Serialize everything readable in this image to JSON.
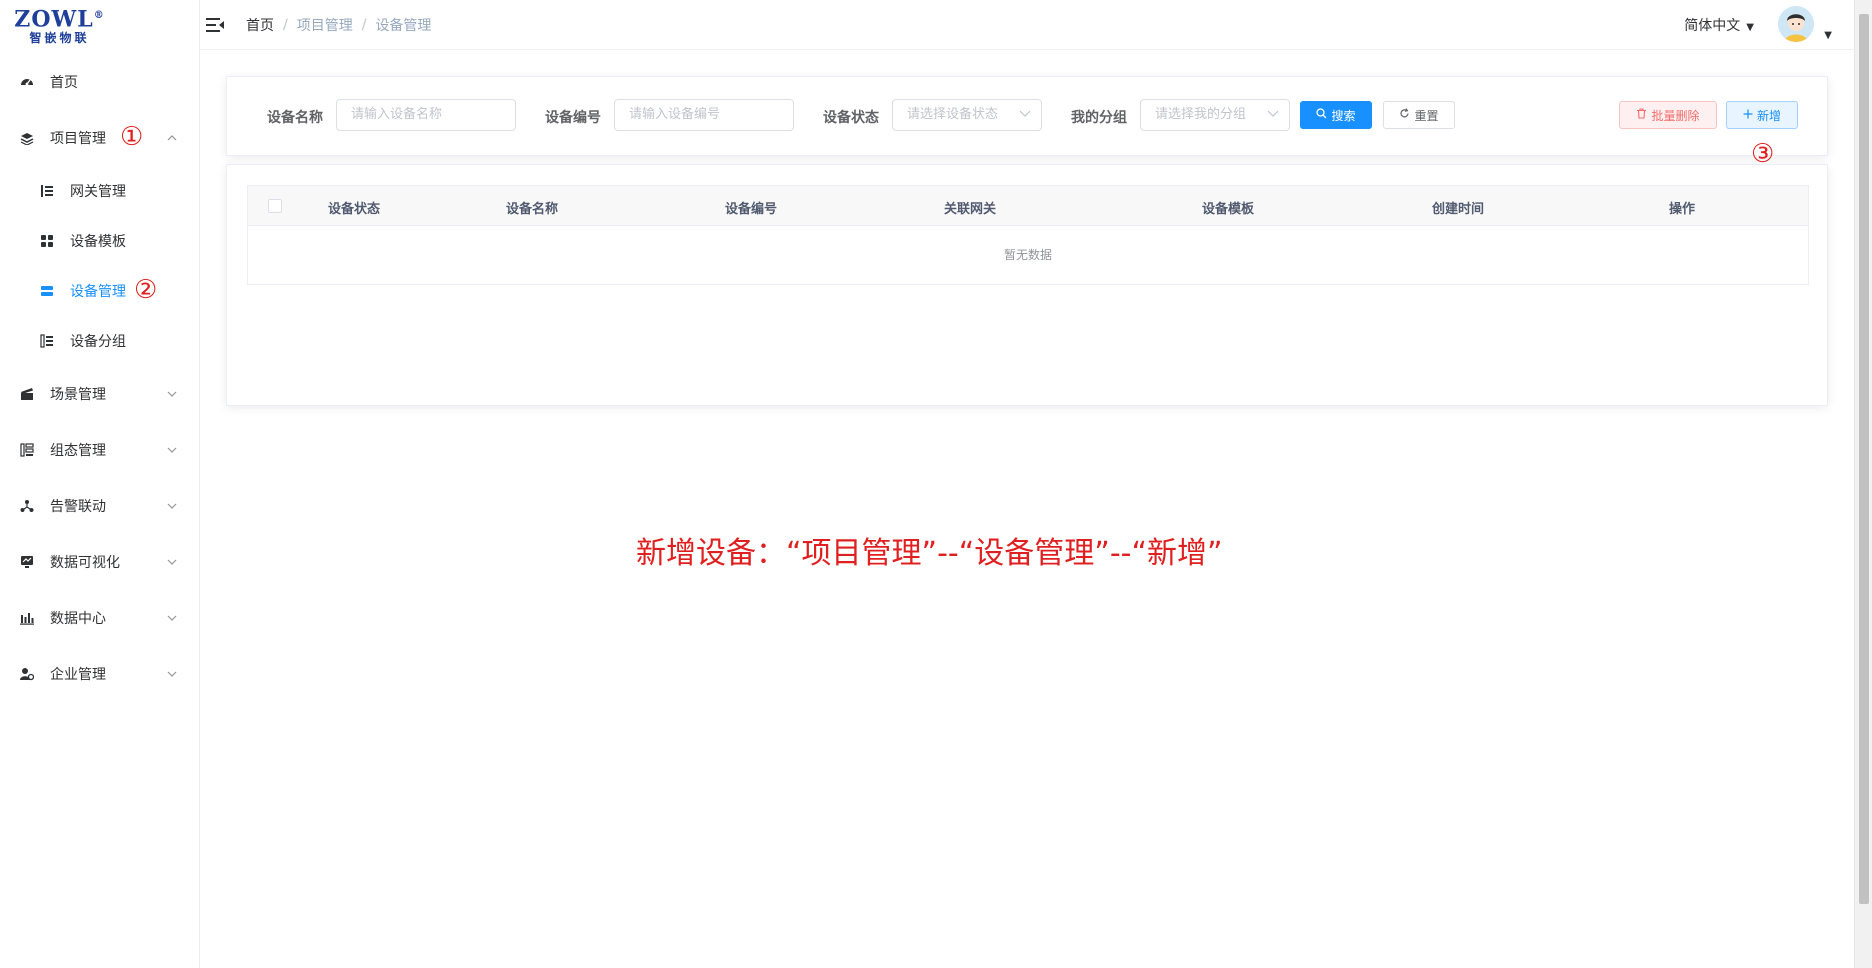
{
  "logo": {
    "mark": "ZOWL",
    "reg": "®",
    "sub": "智嵌物联"
  },
  "sidebar": {
    "items": [
      {
        "label": "首页",
        "icon": "dashboard-icon"
      },
      {
        "label": "项目管理",
        "icon": "layers-icon",
        "expanded": true,
        "annotation": "①"
      },
      {
        "label": "网关管理",
        "icon": "tree-list-icon",
        "child": true
      },
      {
        "label": "设备模板",
        "icon": "grid-icon",
        "child": true
      },
      {
        "label": "设备管理",
        "icon": "server-icon",
        "child": true,
        "active": true,
        "annotation": "②"
      },
      {
        "label": "设备分组",
        "icon": "group-list-icon",
        "child": true
      },
      {
        "label": "场景管理",
        "icon": "clapper-icon"
      },
      {
        "label": "组态管理",
        "icon": "config-icon"
      },
      {
        "label": "告警联动",
        "icon": "share-icon"
      },
      {
        "label": "数据可视化",
        "icon": "monitor-icon"
      },
      {
        "label": "数据中心",
        "icon": "bar-chart-icon"
      },
      {
        "label": "企业管理",
        "icon": "user-gear-icon"
      }
    ]
  },
  "header": {
    "breadcrumb": [
      "首页",
      "项目管理",
      "设备管理"
    ],
    "language": "简体中文"
  },
  "search": {
    "device_name_label": "设备名称",
    "device_name_placeholder": "请输入设备名称",
    "device_no_label": "设备编号",
    "device_no_placeholder": "请输入设备编号",
    "device_status_label": "设备状态",
    "device_status_placeholder": "请选择设备状态",
    "group_label": "我的分组",
    "group_placeholder": "请选择我的分组",
    "search_button": "搜索",
    "reset_button": "重置",
    "batch_delete_button": "批量删除",
    "add_button": "新增",
    "add_annotation": "③"
  },
  "table": {
    "columns": [
      "设备状态",
      "设备名称",
      "设备编号",
      "关联网关",
      "设备模板",
      "创建时间",
      "操作"
    ],
    "empty_text": "暂无数据"
  },
  "annotation": "新增设备：“项目管理”--“设备管理”--“新增”",
  "colors": {
    "primary": "#1890ff",
    "danger": "#f56c6c",
    "annotation": "#e02020"
  }
}
